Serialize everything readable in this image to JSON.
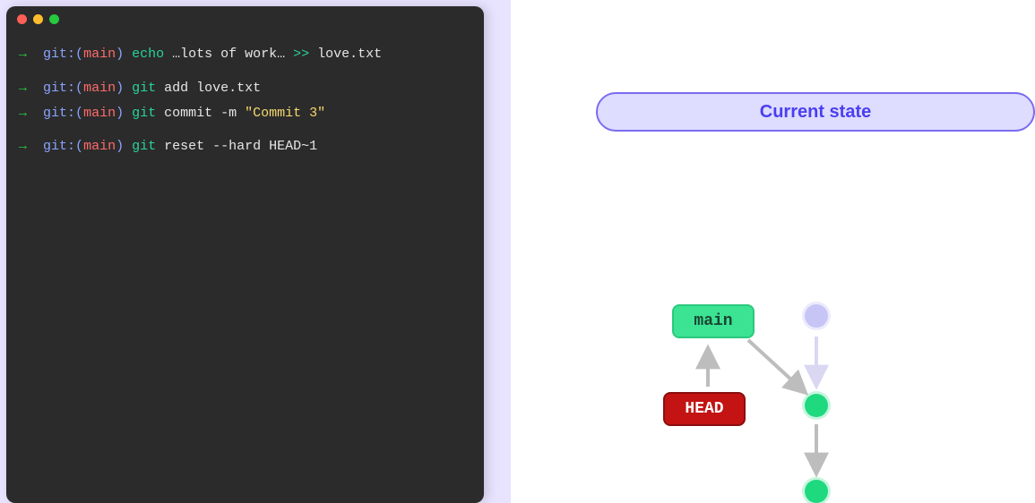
{
  "terminal": {
    "lines": [
      {
        "cmd_kw": "echo",
        "rest_plain": " …lots of work… ",
        "rest_kw2": ">>",
        "rest_tail": " love.txt"
      },
      {
        "cmd_kw": "git",
        "rest_plain": " add love.txt"
      },
      {
        "cmd_kw": "git",
        "rest_plain": " commit -m ",
        "string": "\"Commit 3\""
      },
      {
        "cmd_kw": "git",
        "rest_plain": " reset --hard HEAD~1"
      }
    ],
    "prompt": {
      "arrow": "→",
      "git_label": "git:",
      "paren_open": "(",
      "branch": "main",
      "paren_close": ")"
    }
  },
  "state_label": "Current state",
  "graph": {
    "main_label": "main",
    "head_label": "HEAD"
  }
}
